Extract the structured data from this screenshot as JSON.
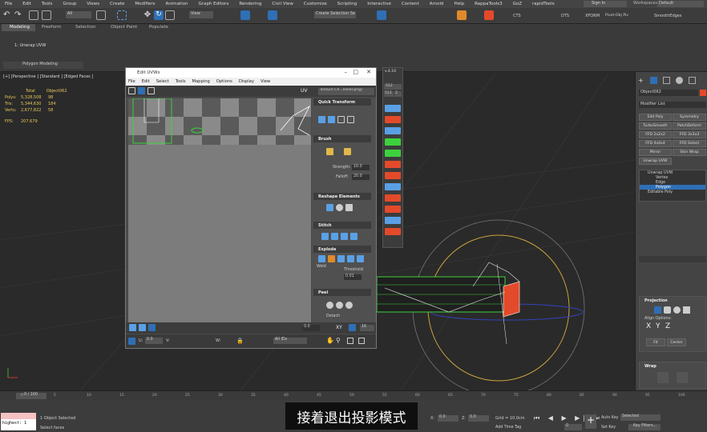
{
  "menu": [
    "File",
    "Edit",
    "Tools",
    "Group",
    "Views",
    "Create",
    "Modifiers",
    "Animation",
    "Graph Editors",
    "Rendering",
    "Civil View",
    "Customize",
    "Scripting",
    "Interactive",
    "Content",
    "Arnold",
    "Help",
    "RappaTools3",
    "GoZ",
    "rapidTools"
  ],
  "account": {
    "signin": "Sign In",
    "workspaces_label": "Workspaces:",
    "workspace": "Default"
  },
  "toolbar": {
    "filter_all": "All",
    "view": "View",
    "create_selection": "Create Selection Se",
    "labels": [
      "CTS",
      "DTS",
      "XFORM",
      "Pivot-Obj Piv",
      "SmoothEdges"
    ]
  },
  "ribbon": {
    "tabs": [
      "Modeling",
      "Freeform",
      "Selection",
      "Object Paint",
      "Populate"
    ],
    "stack_item": "1: Unwrap UVW",
    "polygon_modeling": "Polygon Modeling"
  },
  "viewport": {
    "label": "[+] [Perspective ] [Standard ] [Edged Faces ]",
    "stats": {
      "total_label": "Total",
      "object_label": "Object062",
      "rows": [
        {
          "k": "Polys:",
          "total": "5,328,508",
          "obj": "98"
        },
        {
          "k": "Tris:",
          "total": "5,344,630",
          "obj": "184"
        },
        {
          "k": "Verts:",
          "total": "2,677,822",
          "obj": "58"
        }
      ],
      "fps_label": "FPS:",
      "fps": "207.679"
    }
  },
  "uvw": {
    "title": "Edit UVWs",
    "menu": [
      "File",
      "Edit",
      "Select",
      "Tools",
      "Mapping",
      "Options",
      "Display",
      "View"
    ],
    "uv_label": "UV",
    "texture": "Texture Ch...ecker.png)",
    "sections": {
      "quick_transform": "Quick Transform",
      "brush": "Brush",
      "reshape": "Reshape Elements",
      "stitch": "Stitch",
      "explode": "Explode",
      "peel": "Peel"
    },
    "brush": {
      "strength_label": "Strength:",
      "strength": "10.0",
      "falloff_label": "Falloff:",
      "falloff": "20.0"
    },
    "explode": {
      "weld": "Weld",
      "threshold_label": "Threshold:",
      "threshold": "0.01"
    },
    "peel": {
      "detach": "Detach"
    },
    "bottom": {
      "value": "0.0",
      "xy": "XY",
      "zoom": "16",
      "u_label": "U:",
      "u": "0.0",
      "v_label": "V:",
      "w_label": "W:",
      "all_ids": "All IDs"
    }
  },
  "version_tag": "v.4.10",
  "side_panel": {
    "nums": [
      "512",
      "512",
      "2"
    ]
  },
  "cmd": {
    "object_name": "Object062",
    "modifier_list": "Modifier List",
    "buttons": [
      [
        "Edit Poly",
        "Symmetry"
      ],
      [
        "TurboSmooth",
        "PatchDeform"
      ],
      [
        "FFD 2x2x2",
        "FFD 3x3x3"
      ],
      [
        "FFD 4x4x4",
        "FFD Select"
      ],
      [
        "Mirror",
        "Skin Wrap"
      ],
      [
        "Unwrap UVW",
        ""
      ]
    ],
    "stack": [
      "Unwrap UVW",
      "Vertex",
      "Edge",
      "Polygon",
      "Editable Poly"
    ],
    "projection": "Projection",
    "align_options": "Align Options:",
    "xyz": [
      "X",
      "Y",
      "Z"
    ],
    "fit": "Fit",
    "center": "Center",
    "wrap": "Wrap"
  },
  "timeline": {
    "frame": "0 / 100",
    "ticks": [
      "0",
      "5",
      "10",
      "15",
      "20",
      "25",
      "30",
      "35",
      "40",
      "45",
      "50",
      "55",
      "60",
      "65",
      "70",
      "75",
      "80",
      "85",
      "90",
      "95",
      "100"
    ]
  },
  "status": {
    "script": "highest: 1",
    "selected": "1 Object Selected",
    "select_faces": "Select faces",
    "x_label": "X:",
    "x": "0.0",
    "y_label": "Y:",
    "y": "0.0",
    "z_label": "Z:",
    "z": "0.0",
    "grid": "Grid = 10.0cm",
    "add_time_tag": "Add Time Tag",
    "auto_key": "Auto Key",
    "set_key": "Set Key",
    "selected_dd": "Selected",
    "key_filters": "Key Filters...",
    "frame": "0"
  },
  "subtitle": "接着退出投影模式",
  "colors": {
    "accent": "#2f6fb5",
    "stats": "#e8c85a",
    "selection_green": "#3cd23c",
    "highlight_red": "#e34a2a"
  }
}
